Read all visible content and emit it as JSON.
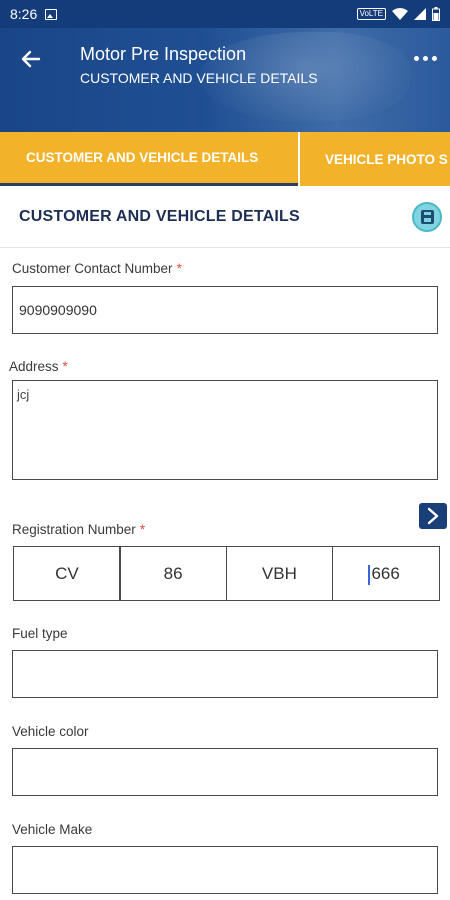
{
  "status_bar": {
    "time": "8:26",
    "network": "VoLTE"
  },
  "header": {
    "title": "Motor Pre Inspection",
    "subtitle": "CUSTOMER AND VEHICLE DETAILS"
  },
  "tabs": [
    {
      "label": "CUSTOMER AND VEHICLE DETAILS",
      "active": true
    },
    {
      "label": "VEHICLE PHOTO S",
      "active": false
    }
  ],
  "section": {
    "title": "CUSTOMER AND VEHICLE DETAILS"
  },
  "form": {
    "contact": {
      "label": "Customer Contact Number",
      "required_mark": "*",
      "value": "9090909090"
    },
    "address": {
      "label": "Address",
      "required_mark": "*",
      "value": "jcj"
    },
    "registration": {
      "label": "Registration Number",
      "required_mark": "*",
      "parts": [
        "CV",
        "86",
        "VBH",
        "666"
      ]
    },
    "fuel_type": {
      "label": "Fuel type",
      "value": ""
    },
    "vehicle_color": {
      "label": "Vehicle color",
      "value": ""
    },
    "vehicle_make": {
      "label": "Vehicle Make",
      "value": ""
    }
  },
  "colors": {
    "header": "#1f4f93",
    "tab": "#f2b32a",
    "accent": "#1a3e78"
  }
}
